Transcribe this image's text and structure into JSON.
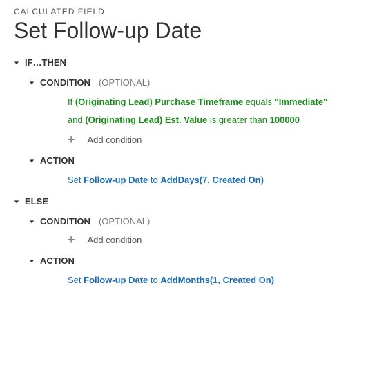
{
  "breadcrumb": "CALCULATED FIELD",
  "title": "Set Follow-up Date",
  "labels": {
    "if_then": "IF…THEN",
    "else": "ELSE",
    "condition": "CONDITION",
    "optional": "(OPTIONAL)",
    "action": "ACTION",
    "add_condition": "Add condition"
  },
  "if_branch": {
    "cond1": {
      "prefix": "If ",
      "field": "(Originating Lead) Purchase Timeframe",
      "op": " equals ",
      "value": "\"Immediate\""
    },
    "cond2": {
      "prefix": "and ",
      "field": "(Originating Lead) Est. Value",
      "op": " is greater than ",
      "value": "100000"
    },
    "action": {
      "prefix": "Set ",
      "field": "Follow-up Date",
      "mid": " to ",
      "func": "AddDays(7, Created On)"
    }
  },
  "else_branch": {
    "action": {
      "prefix": "Set ",
      "field": "Follow-up Date",
      "mid": " to ",
      "func": "AddMonths(1, Created On)"
    }
  }
}
